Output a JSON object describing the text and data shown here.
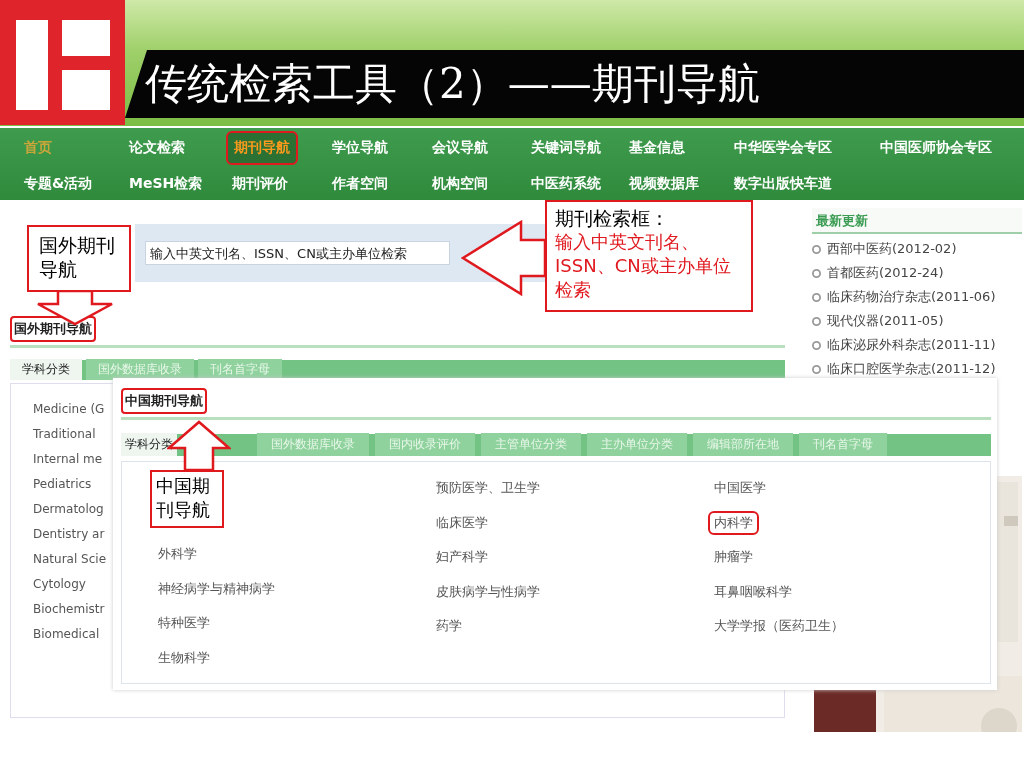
{
  "slide": {
    "title": "传统检索工具（2）——期刊导航"
  },
  "nav": {
    "rows": [
      [
        {
          "label": "首页",
          "kind": "home",
          "selected": false,
          "highlighted": false
        },
        {
          "label": "论文检索",
          "kind": "link",
          "selected": false,
          "highlighted": false
        },
        {
          "label": "期刊导航",
          "kind": "link",
          "selected": true,
          "highlighted": true
        },
        {
          "label": "学位导航",
          "kind": "link",
          "selected": false,
          "highlighted": false
        },
        {
          "label": "会议导航",
          "kind": "link",
          "selected": false,
          "highlighted": false
        },
        {
          "label": "关键词导航",
          "kind": "link",
          "selected": false,
          "highlighted": false
        },
        {
          "label": "基金信息",
          "kind": "link",
          "selected": false,
          "highlighted": false
        },
        {
          "label": "中华医学会专区",
          "kind": "link",
          "selected": false,
          "highlighted": false
        },
        {
          "label": "中国医师协会专区",
          "kind": "link",
          "selected": false,
          "highlighted": false
        }
      ],
      [
        {
          "label": "专题&活动",
          "kind": "link",
          "selected": false,
          "highlighted": false
        },
        {
          "label": "MeSH检索",
          "kind": "link",
          "selected": false,
          "highlighted": false
        },
        {
          "label": "期刊评价",
          "kind": "link",
          "selected": false,
          "highlighted": false
        },
        {
          "label": "作者空间",
          "kind": "link",
          "selected": false,
          "highlighted": false
        },
        {
          "label": "机构空间",
          "kind": "link",
          "selected": false,
          "highlighted": false
        },
        {
          "label": "中医药系统",
          "kind": "link",
          "selected": false,
          "highlighted": false
        },
        {
          "label": "视频数据库",
          "kind": "link",
          "selected": false,
          "highlighted": false
        },
        {
          "label": "数字出版快车道",
          "kind": "link",
          "selected": false,
          "highlighted": false
        }
      ]
    ]
  },
  "search": {
    "placeholder": "输入中英文刊名、ISSN、CN或主办单位检索"
  },
  "foreign_nav": {
    "title": "国外期刊导航",
    "highlighted": true,
    "tabs": [
      {
        "label": "学科分类",
        "selected": true
      },
      {
        "label": "国外数据库收录",
        "selected": false
      },
      {
        "label": "刊名首字母",
        "selected": false
      }
    ],
    "subjects": [
      "Medicine (G",
      "Traditional",
      "Internal me",
      "Pediatrics",
      "Dermatolog",
      "Dentistry ar",
      "Natural Scie",
      "Cytology",
      "Biochemistr",
      "Biomedical"
    ]
  },
  "latest": {
    "title": "最新更新",
    "items": [
      "西部中医药(2012-02)",
      "首都医药(2012-24)",
      "临床药物治疗杂志(2011-06)",
      "现代仪器(2011-05)",
      "临床泌尿外科杂志(2011-11)",
      "临床口腔医学杂志(2011-12)"
    ]
  },
  "china_nav": {
    "title": "中国期刊导航",
    "highlighted": true,
    "tabs": [
      {
        "label": "学科分类",
        "selected": true
      },
      {
        "label": "国外数据库收录",
        "selected": false
      },
      {
        "label": "国内收录评价",
        "selected": false
      },
      {
        "label": "主管单位分类",
        "selected": false
      },
      {
        "label": "主办单位分类",
        "selected": false
      },
      {
        "label": "编辑部所在地",
        "selected": false
      },
      {
        "label": "刊名首字母",
        "selected": false
      }
    ],
    "columns": [
      [
        {
          "label": "外科学",
          "highlighted": false
        },
        {
          "label": "神经病学与精神病学",
          "highlighted": false
        },
        {
          "label": "特种医学",
          "highlighted": false
        },
        {
          "label": "生物科学",
          "highlighted": false
        }
      ],
      [
        {
          "label": "预防医学、卫生学",
          "highlighted": false
        },
        {
          "label": "临床医学",
          "highlighted": false
        },
        {
          "label": "妇产科学",
          "highlighted": false
        },
        {
          "label": "皮肤病学与性病学",
          "highlighted": false
        },
        {
          "label": "药学",
          "highlighted": false
        }
      ],
      [
        {
          "label": "中国医学",
          "highlighted": false
        },
        {
          "label": "内科学",
          "highlighted": true
        },
        {
          "label": "肿瘤学",
          "highlighted": false
        },
        {
          "label": "耳鼻咽喉科学",
          "highlighted": false
        },
        {
          "label": "大学学报（医药卫生）",
          "highlighted": false
        }
      ]
    ]
  },
  "callouts": [
    {
      "kind": "down",
      "text": "国外期刊导航"
    },
    {
      "kind": "left",
      "title": "期刊检索框：",
      "text": "输入中英文刊名、ISSN、CN或主办单位检索"
    },
    {
      "kind": "up",
      "text": "中国期刊导航"
    }
  ]
}
